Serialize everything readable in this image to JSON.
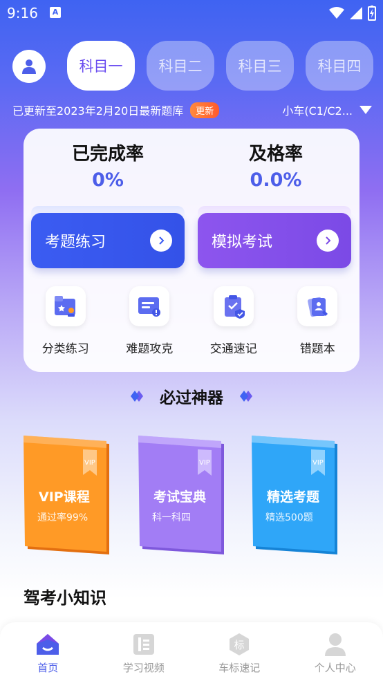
{
  "status_bar": {
    "time": "9:16"
  },
  "header": {
    "tabs": [
      {
        "label": "科目一",
        "active": true
      },
      {
        "label": "科目二",
        "active": false
      },
      {
        "label": "科目三",
        "active": false
      },
      {
        "label": "科目四",
        "active": false
      }
    ],
    "update_text": "已更新至2023年2月20日最新题库",
    "update_badge": "更新",
    "car_type": "小车(C1/C2..."
  },
  "stats": {
    "completion_title": "已完成率",
    "completion_value": "0%",
    "pass_title": "及格率",
    "pass_value": "0.0%"
  },
  "actions": {
    "practice_label": "考题练习",
    "exam_label": "模拟考试"
  },
  "tools": [
    {
      "label": "分类练习",
      "icon": "folder-star-icon"
    },
    {
      "label": "难题攻克",
      "icon": "warning-card-icon"
    },
    {
      "label": "交通速记",
      "icon": "clipboard-shield-icon"
    },
    {
      "label": "错题本",
      "icon": "notebook-icon"
    }
  ],
  "section": {
    "title": "必过神器"
  },
  "books": [
    {
      "title": "VIP课程",
      "subtitle": "通过率99%",
      "badge": "VIP",
      "color": "#ff9a26"
    },
    {
      "title": "考试宝典",
      "subtitle": "科一科四",
      "badge": "VIP",
      "color": "#a27df5"
    },
    {
      "title": "精选考题",
      "subtitle": "精选500题",
      "badge": "VIP",
      "color": "#2fa6f8"
    }
  ],
  "knowledge_title": "驾考小知识",
  "bottom_nav": [
    {
      "label": "首页",
      "icon": "home-icon",
      "active": true
    },
    {
      "label": "学习视频",
      "icon": "video-icon",
      "active": false
    },
    {
      "label": "车标速记",
      "icon": "car-badge-icon",
      "active": false
    },
    {
      "label": "个人中心",
      "icon": "person-icon",
      "active": false
    }
  ],
  "colors": {
    "accent": "#4d5ee9",
    "purple": "#7b4ae6"
  }
}
